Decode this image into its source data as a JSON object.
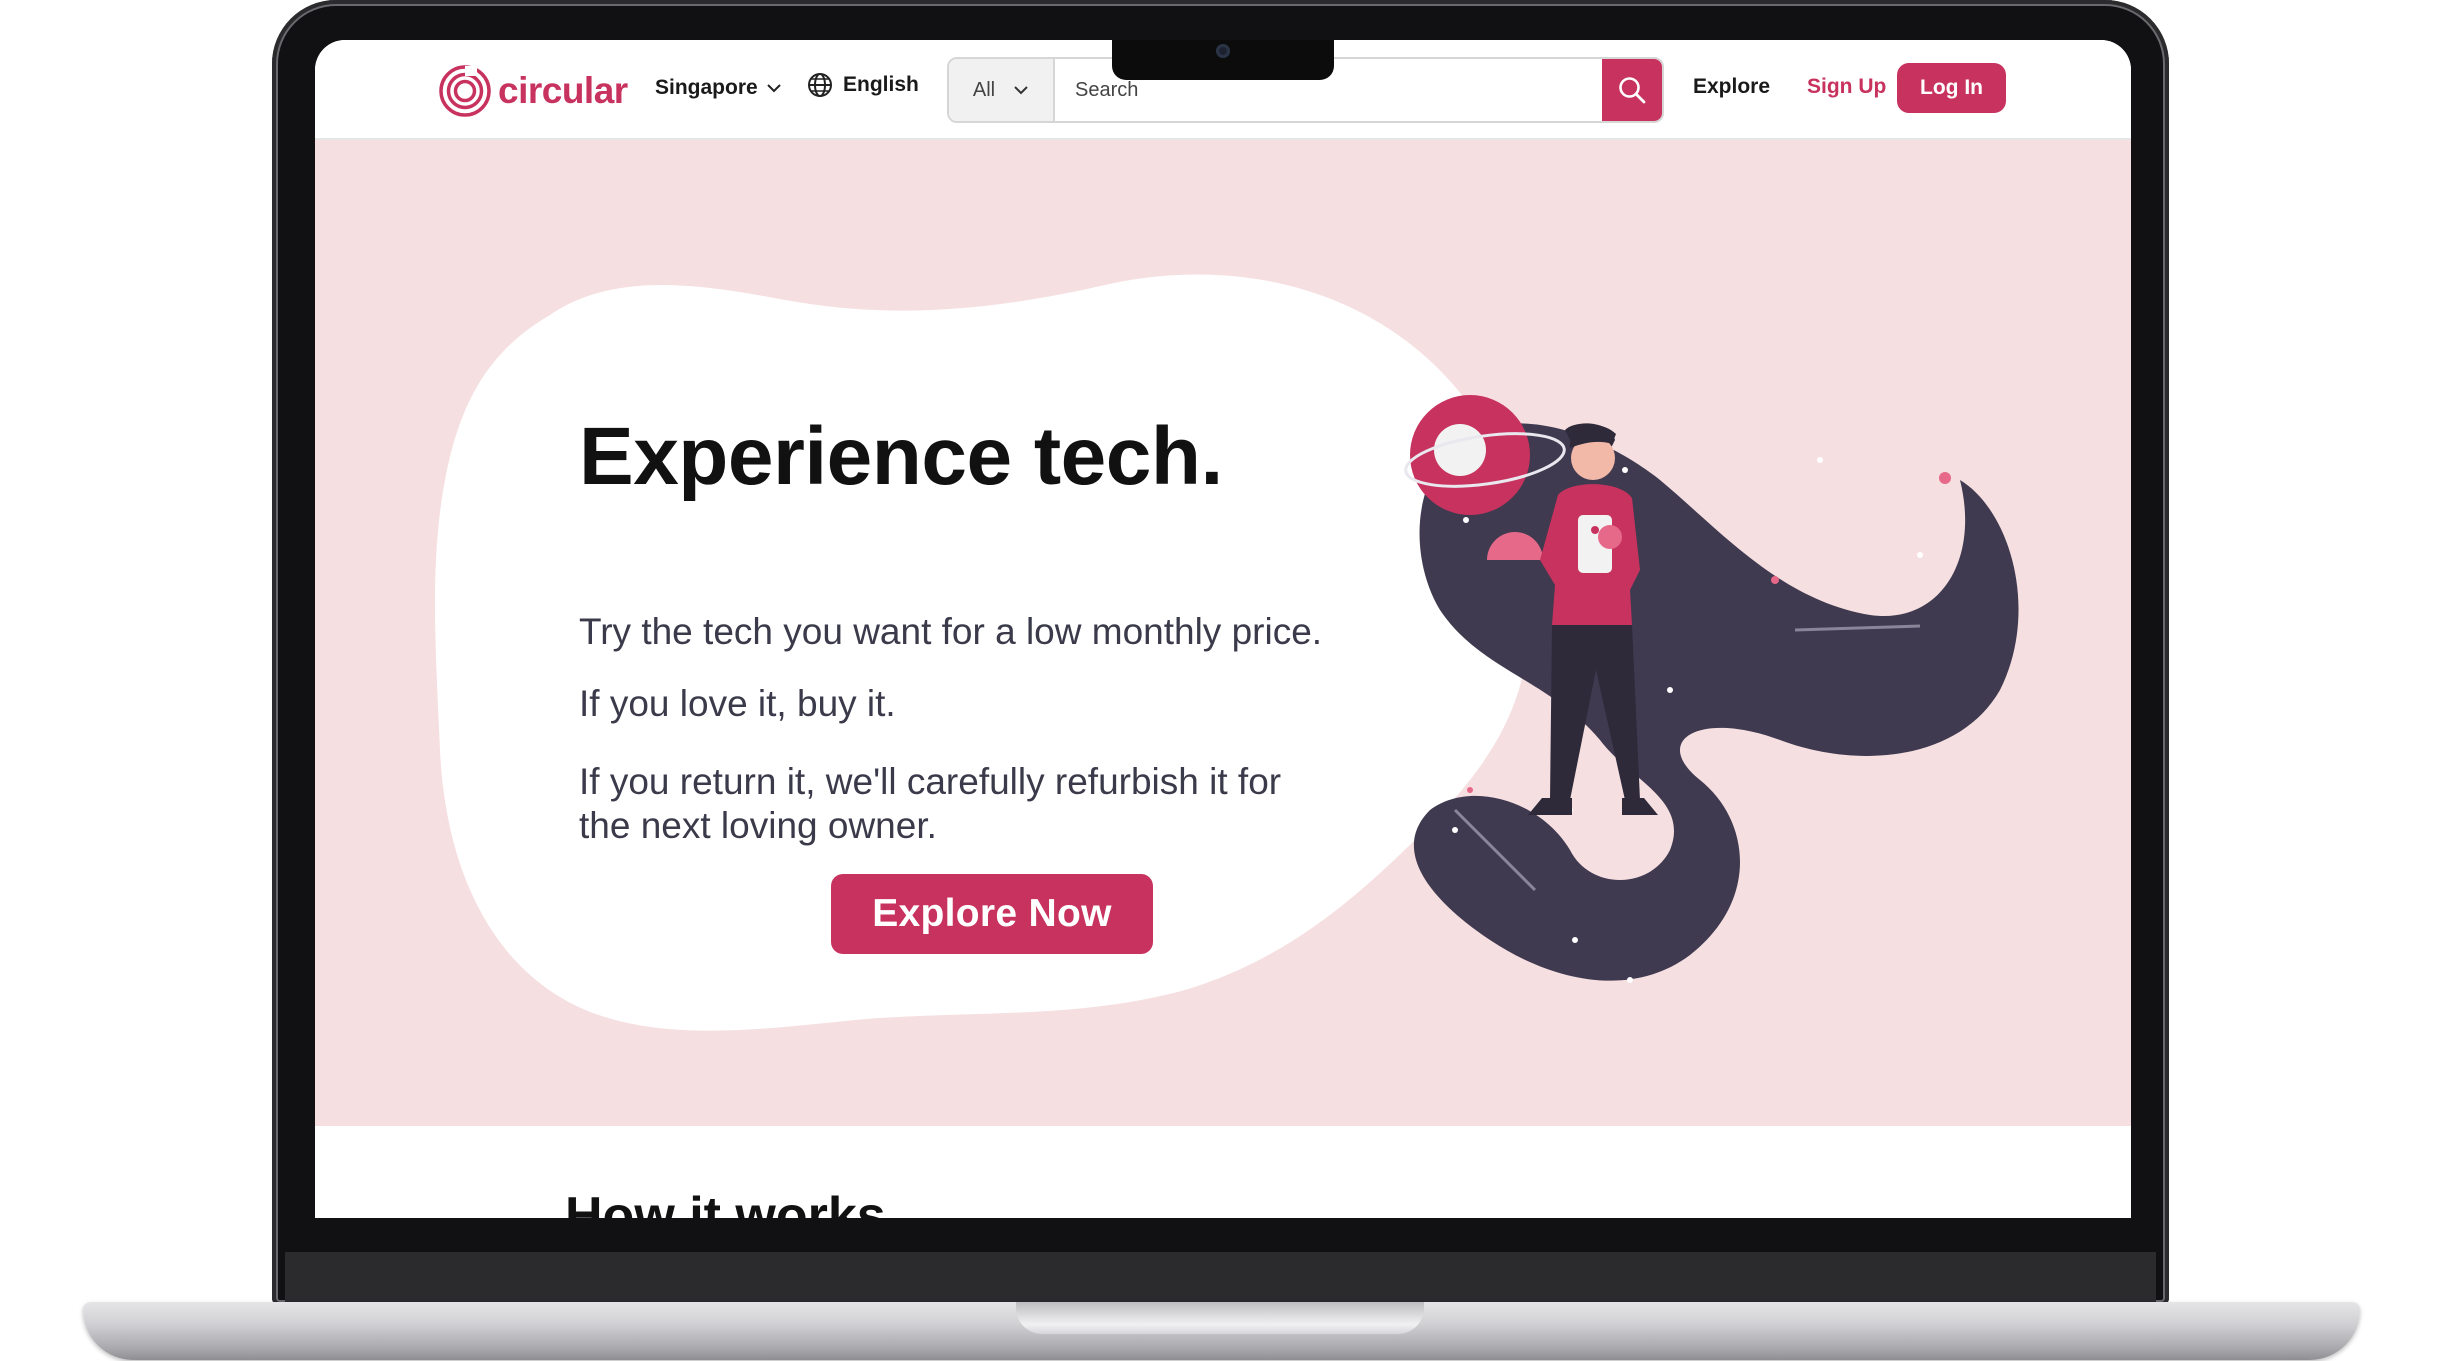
{
  "brand": {
    "name": "circular",
    "color": "#c8325e"
  },
  "header": {
    "region": "Singapore",
    "language": "English",
    "search": {
      "category": "All",
      "placeholder": "Search"
    },
    "nav": {
      "explore": "Explore",
      "signup": "Sign Up",
      "login": "Log In"
    }
  },
  "hero": {
    "title": "Experience tech.",
    "line1": "Try the tech you want for a low monthly price.",
    "line2": "If you love it, buy it.",
    "line3": "If you return it, we'll carefully refurbish it for the next loving owner.",
    "cta": "Explore Now"
  },
  "next_section": {
    "title": "How it works"
  },
  "colors": {
    "accent": "#c8325e",
    "hero_bg": "#f6dfe1",
    "space_dark": "#3f3a4f"
  },
  "icons": [
    "logo-ring-icon",
    "chevron-down-icon",
    "globe-icon",
    "search-icon"
  ]
}
